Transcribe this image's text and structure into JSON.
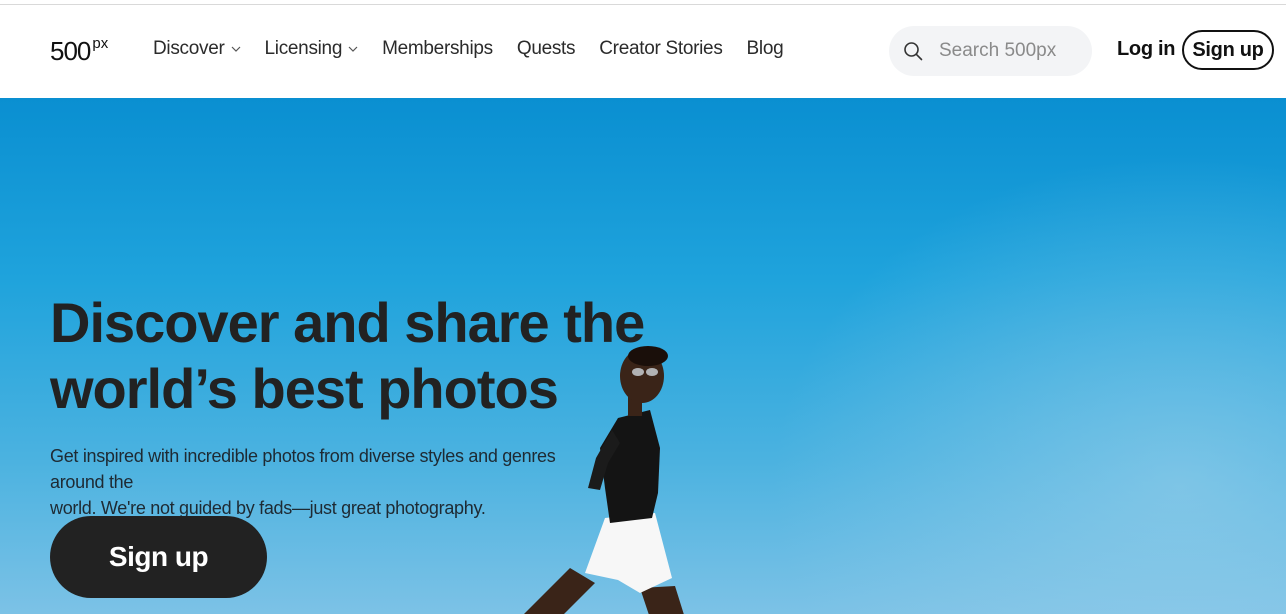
{
  "header": {
    "logo": {
      "number": "500",
      "suffix": "px"
    },
    "nav": [
      {
        "label": "Discover",
        "has_dropdown": true
      },
      {
        "label": "Licensing",
        "has_dropdown": true
      },
      {
        "label": "Memberships",
        "has_dropdown": false
      },
      {
        "label": "Quests",
        "has_dropdown": false
      },
      {
        "label": "Creator Stories",
        "has_dropdown": false
      },
      {
        "label": "Blog",
        "has_dropdown": false
      }
    ],
    "search": {
      "placeholder": "Search 500px",
      "icon": "search-icon"
    },
    "login_label": "Log in",
    "signup_label": "Sign up"
  },
  "hero": {
    "title_line1": "Discover and share the",
    "title_line2": "world’s best photos",
    "subtitle_line1": "Get inspired with incredible photos from diverse styles and genres around the",
    "subtitle_line2": "world. We're not guided by fads—just great photography.",
    "cta_label": "Sign up",
    "image": "model-against-blue-sky"
  },
  "colors": {
    "sky_top": "#0a8fd1",
    "sky_bottom": "#7cc2e6",
    "text_dark": "#222222",
    "cta_bg": "#222222",
    "search_bg": "#f3f4f6"
  }
}
